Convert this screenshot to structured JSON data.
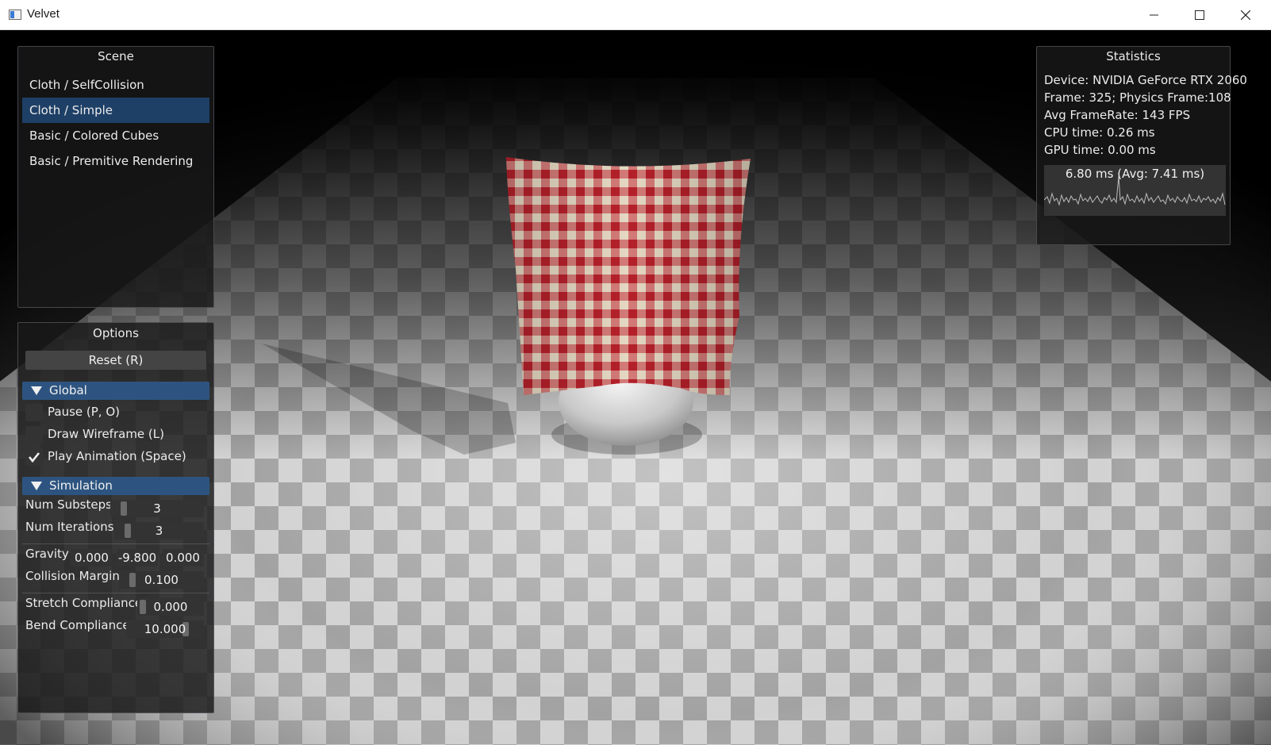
{
  "window": {
    "title": "Velvet",
    "controls": [
      "minimize-icon",
      "maximize-icon",
      "close-icon"
    ]
  },
  "scene_panel": {
    "title": "Scene",
    "items": [
      {
        "label": "Cloth / SelfCollision",
        "selected": false
      },
      {
        "label": "Cloth / Simple",
        "selected": true
      },
      {
        "label": "Basic / Colored Cubes",
        "selected": false
      },
      {
        "label": "Basic / Premitive Rendering",
        "selected": false
      }
    ]
  },
  "options_panel": {
    "title": "Options",
    "reset_label": "Reset (R)",
    "global": {
      "header": "Global",
      "checkboxes": [
        {
          "label": "Pause (P, O)",
          "checked": false
        },
        {
          "label": "Draw Wireframe (L)",
          "checked": false
        },
        {
          "label": "Play Animation (Space)",
          "checked": true
        }
      ]
    },
    "simulation": {
      "header": "Simulation",
      "num_substeps": {
        "label": "Num Substeps",
        "value": "3"
      },
      "num_iterations": {
        "label": "Num Iterations",
        "value": "3"
      },
      "gravity": {
        "label": "Gravity",
        "x": "0.000",
        "y": "-9.800",
        "z": "0.000"
      },
      "collision_margin": {
        "label": "Collision Margin",
        "value": "0.100"
      },
      "stretch_compliance": {
        "label": "Stretch Compliance",
        "value": "0.000"
      },
      "bend_compliance": {
        "label": "Bend Compliance",
        "value": "10.000"
      }
    }
  },
  "statistics_panel": {
    "title": "Statistics",
    "device": "Device:  NVIDIA GeForce RTX 2060",
    "frame": "Frame:  325; Physics Frame:108",
    "framerate": "Avg FrameRate:  143 FPS",
    "cpu_time": "CPU time:  0.26 ms",
    "gpu_time": "GPU time:  0.00 ms",
    "plot_label": "6.80 ms (Avg: 7.41 ms)"
  },
  "colors": {
    "panel_bg": "#181818",
    "selected_item": "#1e3f66",
    "section_header": "#2d5480",
    "cloth_red": "#c0282e",
    "cloth_cream": "#e6dcc8"
  }
}
